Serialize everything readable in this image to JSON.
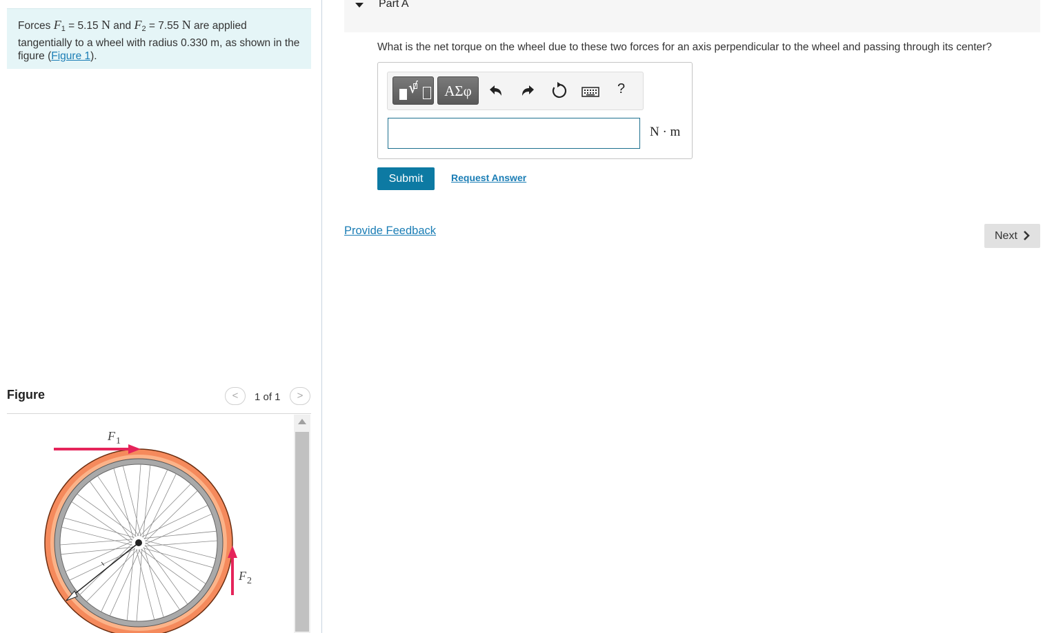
{
  "problem": {
    "text_prefix": "Forces ",
    "f1_var": "F",
    "f1_sub": "1",
    "f1_eq": " = 5.15 ",
    "f1_unit": "N",
    "and_text": " and ",
    "f2_var": "F",
    "f2_sub": "2",
    "f2_eq": " = 7.55 ",
    "f2_unit": "N",
    "text_suffix": " are applied tangentially to a wheel with radius 0.330 m, as shown in the figure (",
    "figure_link": "Figure 1",
    "text_end": ")."
  },
  "figure": {
    "title": "Figure",
    "page_indicator": "1 of 1",
    "prev_symbol": "<",
    "next_symbol": ">",
    "f1_label": "F",
    "f1_sub": "1",
    "f2_label": "F",
    "f2_sub": "2",
    "f1_color": "#e5245a",
    "f2_color": "#e5245a",
    "tire_color": "#f58a5c"
  },
  "part": {
    "title": "Part A",
    "question": "What is the net torque on the wheel due to these two forces for an axis perpendicular to the wheel and passing through its center?"
  },
  "toolbar": {
    "greek_label": "ΑΣφ",
    "help_label": "?",
    "icons": [
      "templates-icon",
      "greek-symbols-icon",
      "undo-icon",
      "redo-icon",
      "reset-icon",
      "keyboard-icon",
      "help-icon"
    ]
  },
  "answer": {
    "value": "",
    "unit": "N · m"
  },
  "actions": {
    "submit": "Submit",
    "request_answer": "Request Answer",
    "provide_feedback": "Provide Feedback",
    "next": "Next"
  },
  "colors": {
    "accent": "#0d7aa3",
    "link": "#1a7db5",
    "problem_bg": "#e5f5f7"
  }
}
